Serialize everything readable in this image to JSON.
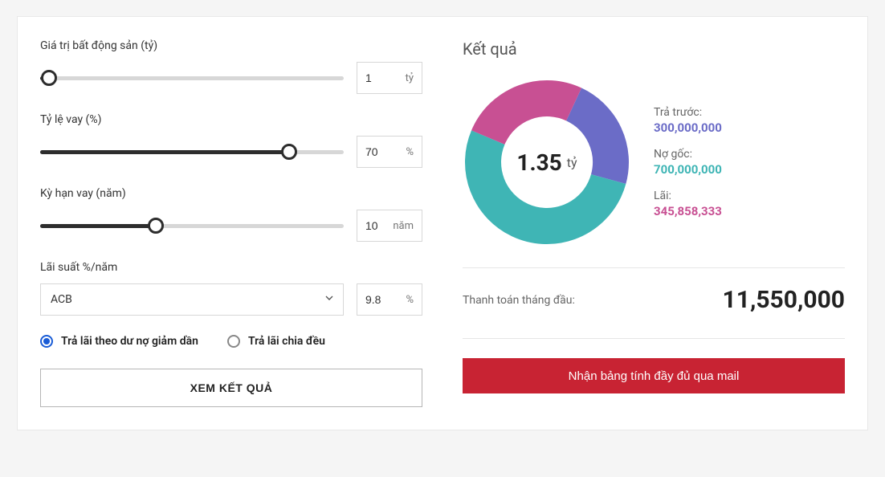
{
  "form": {
    "property_value": {
      "label": "Giá trị bất động sản (tỷ)",
      "value": "1",
      "unit": "tỷ",
      "percent": 3
    },
    "loan_ratio": {
      "label": "Tỷ lệ vay (%)",
      "value": "70",
      "unit": "%",
      "percent": 82
    },
    "term": {
      "label": "Kỳ hạn vay (năm)",
      "value": "10",
      "unit": "năm",
      "percent": 38
    },
    "interest": {
      "label": "Lãi suất %/năm",
      "bank": "ACB",
      "rate": "9.8",
      "unit": "%"
    },
    "radios": {
      "option1": "Trả lãi theo dư nợ giảm dần",
      "option2": "Trả lãi chia đều"
    },
    "submit": "XEM KẾT QUẢ"
  },
  "result": {
    "title": "Kết quả",
    "total_value": "1.35",
    "total_unit": "tỷ",
    "legend": {
      "upfront_label": "Trả trước:",
      "upfront_value": "300,000,000",
      "principal_label": "Nợ gốc:",
      "principal_value": "700,000,000",
      "interest_label": "Lãi:",
      "interest_value": "345,858,333"
    },
    "monthly_label": "Thanh toán tháng đầu:",
    "monthly_value": "11,550,000",
    "mail_button": "Nhận bảng tính đầy đủ qua mail"
  },
  "chart_data": {
    "type": "pie",
    "title": "Kết quả",
    "series": [
      {
        "name": "Trả trước",
        "value": 300000000,
        "color": "#6b6cc7"
      },
      {
        "name": "Nợ gốc",
        "value": 700000000,
        "color": "#3fb5b5"
      },
      {
        "name": "Lãi",
        "value": 345858333,
        "color": "#c85093"
      }
    ],
    "center_label": "1.35 tỷ"
  }
}
